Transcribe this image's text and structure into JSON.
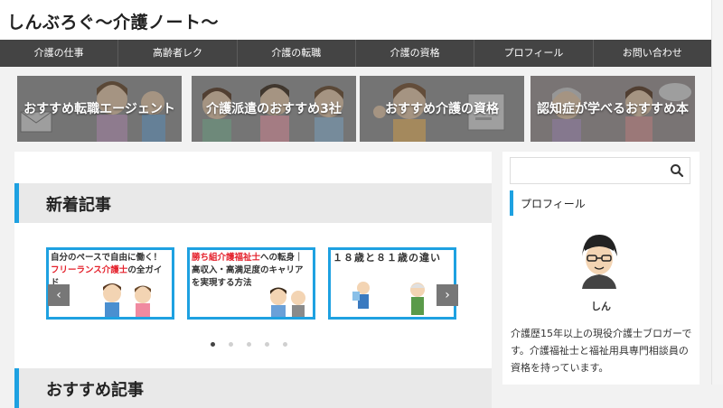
{
  "site": {
    "title": "しんぶろぐ〜介護ノート〜"
  },
  "nav": [
    {
      "label": "介護の仕事"
    },
    {
      "label": "高齢者レク"
    },
    {
      "label": "介護の転職"
    },
    {
      "label": "介護の資格"
    },
    {
      "label": "プロフィール"
    },
    {
      "label": "お問い合わせ"
    }
  ],
  "banners": [
    {
      "label": "おすすめ転職エージェント"
    },
    {
      "label": "介護派遣のおすすめ3社"
    },
    {
      "label": "おすすめ介護の資格"
    },
    {
      "label": "認知症が学べるおすすめ本"
    }
  ],
  "main": {
    "new_articles_title": "新着記事",
    "cards": [
      {
        "line1": "自分のペースで自由に働く！",
        "highlight": "フリーランス介護士",
        "rest": "の全ガイド"
      },
      {
        "highlight": "勝ち組介護福祉士",
        "rest": "への転身｜高収入・高満足度のキャリアを実現する方法"
      },
      {
        "text": "１８歳と８１歳の違い"
      }
    ],
    "prev_glyph": "‹",
    "next_glyph": "›",
    "dot_count": 5,
    "active_dot": 0,
    "recommended_title": "おすすめ記事"
  },
  "sidebar": {
    "search": {
      "placeholder": "",
      "value": ""
    },
    "profile_title": "プロフィール",
    "profile_name": "しん",
    "profile_bio": "介護歴15年以上の現役介護士ブロガーです。介護福祉士と福祉用具専門相談員の資格を持っています。"
  },
  "colors": {
    "accent": "#1ea1e1",
    "nav_bg": "#444444",
    "highlight_red": "#e4202b"
  },
  "icons": {
    "search": "search-icon",
    "prev": "chevron-left-icon",
    "next": "chevron-right-icon"
  }
}
